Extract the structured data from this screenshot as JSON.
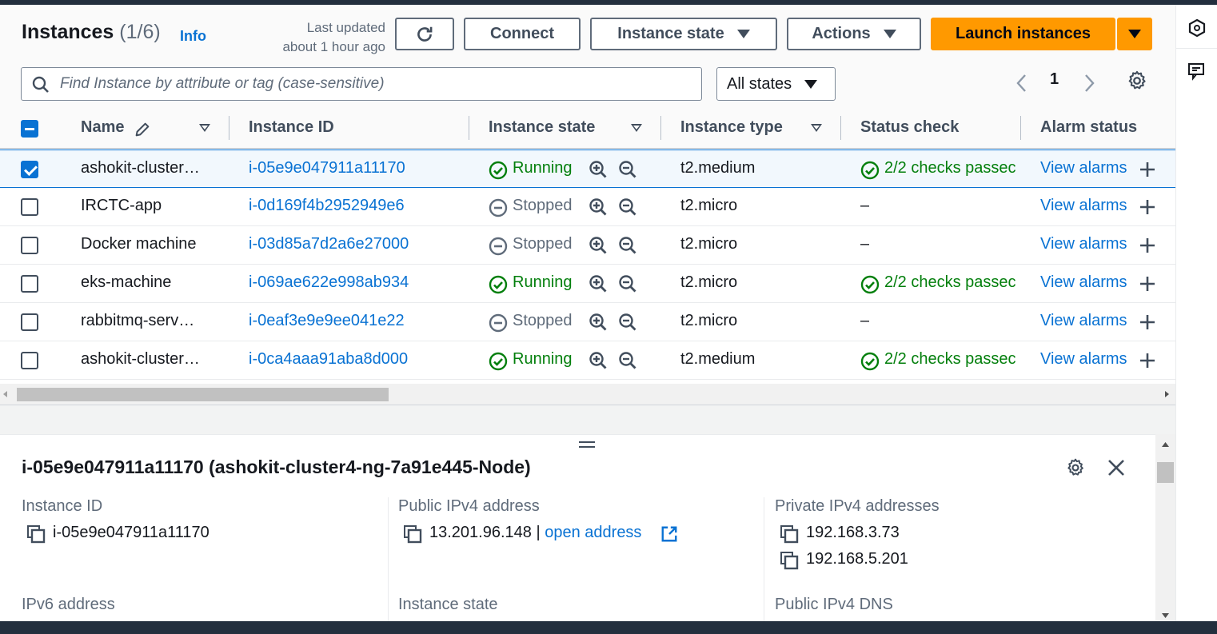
{
  "header": {
    "title": "Instances",
    "count": "(1/6)",
    "info": "Info",
    "last_updated_line1": "Last updated",
    "last_updated_line2": "about 1 hour ago",
    "connect": "Connect",
    "instance_state": "Instance state",
    "actions": "Actions",
    "launch": "Launch instances"
  },
  "filter": {
    "search_placeholder": "Find Instance by attribute or tag (case-sensitive)",
    "states_select": "All states",
    "page": "1"
  },
  "table": {
    "columns": [
      "Name",
      "Instance ID",
      "Instance state",
      "Instance type",
      "Status check",
      "Alarm status"
    ],
    "rows": [
      {
        "selected": true,
        "name": "ashokit-cluster…",
        "id": "i-05e9e047911a11170",
        "state": "Running",
        "type": "t2.medium",
        "status": "2/2 checks passec",
        "alarm": "View alarms"
      },
      {
        "selected": false,
        "name": "IRCTC-app",
        "id": "i-0d169f4b2952949e6",
        "state": "Stopped",
        "type": "t2.micro",
        "status": "–",
        "alarm": "View alarms"
      },
      {
        "selected": false,
        "name": "Docker machine",
        "id": "i-03d85a7d2a6e27000",
        "state": "Stopped",
        "type": "t2.micro",
        "status": "–",
        "alarm": "View alarms"
      },
      {
        "selected": false,
        "name": "eks-machine",
        "id": "i-069ae622e998ab934",
        "state": "Running",
        "type": "t2.micro",
        "status": "2/2 checks passec",
        "alarm": "View alarms"
      },
      {
        "selected": false,
        "name": "rabbitmq-serv…",
        "id": "i-0eaf3e9e9ee041e22",
        "state": "Stopped",
        "type": "t2.micro",
        "status": "–",
        "alarm": "View alarms"
      },
      {
        "selected": false,
        "name": "ashokit-cluster…",
        "id": "i-0ca4aaa91aba8d000",
        "state": "Running",
        "type": "t2.medium",
        "status": "2/2 checks passec",
        "alarm": "View alarms"
      }
    ]
  },
  "detail": {
    "title": "i-05e9e047911a11170 (ashokit-cluster4-ng-7a91e445-Node)",
    "instance_id_label": "Instance ID",
    "instance_id_value": "i-05e9e047911a11170",
    "public_ipv4_label": "Public IPv4 address",
    "public_ipv4_value": "13.201.96.148",
    "separator": "|",
    "open_address": "open address",
    "private_ipv4_label": "Private IPv4 addresses",
    "private_ipv4_values": [
      "192.168.3.73",
      "192.168.5.201"
    ],
    "ipv6_label": "IPv6 address",
    "instance_state_label": "Instance state",
    "public_dns_label": "Public IPv4 DNS"
  },
  "colors": {
    "primary": "#ff9900",
    "link": "#0972d3",
    "success": "#037f0c",
    "muted": "#5f6b7a",
    "topbar": "#232f3e"
  }
}
